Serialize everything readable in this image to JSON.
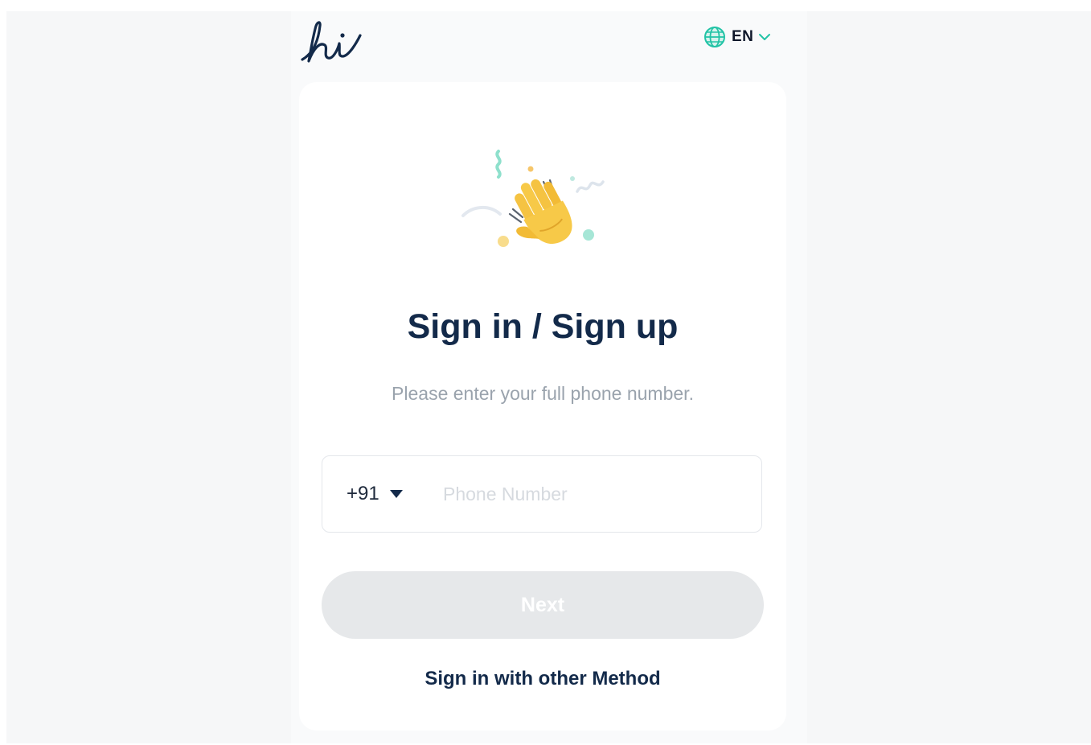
{
  "header": {
    "logo_text": "hi",
    "language": {
      "selected": "EN",
      "icon": "globe-icon",
      "chevron": "chevron-down-icon"
    }
  },
  "signin": {
    "illustration_icon": "waving-hand-icon",
    "title": "Sign in / Sign up",
    "subtitle": "Please enter your full phone number.",
    "country_code": "+91",
    "phone_placeholder": "Phone Number",
    "phone_value": "",
    "next_label": "Next",
    "other_method_label": "Sign in with other Method"
  },
  "colors": {
    "brand_dark": "#132a4a",
    "accent_teal": "#22c3a6",
    "button_disabled": "#e6e8ea",
    "muted_text": "#9aa3ad"
  }
}
